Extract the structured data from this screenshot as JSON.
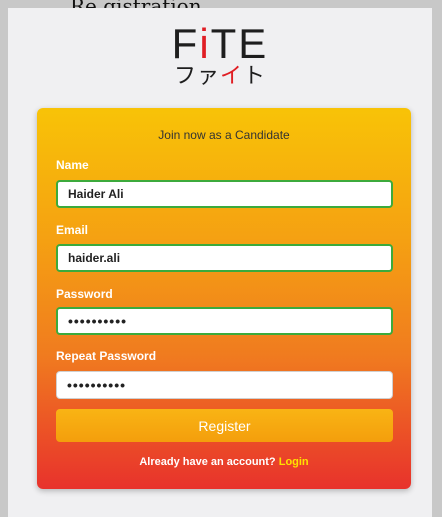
{
  "header": {
    "partial_text": "Re gistration"
  },
  "logo": {
    "latin_prefix": "F",
    "latin_accent": "i",
    "latin_suffix": "TE",
    "kana_prefix": "ファ",
    "kana_accent": "イ",
    "kana_suffix": "ト"
  },
  "form": {
    "title": "Join now as a Candidate",
    "name_label": "Name",
    "name_value": "Haider Ali",
    "email_label": "Email",
    "email_value": "haider.ali",
    "password_label": "Password",
    "password_value": "••••••••••",
    "repeat_label": "Repeat Password",
    "repeat_value": "••••••••••",
    "register_label": "Register",
    "footer_text": "Already have an account? ",
    "login_label": "Login"
  },
  "colors": {
    "accent_red": "#e01e24",
    "gradient_top": "#f8c307",
    "gradient_bottom": "#e8322c",
    "valid_border": "#3caa3c",
    "login_link": "#ffe100"
  }
}
